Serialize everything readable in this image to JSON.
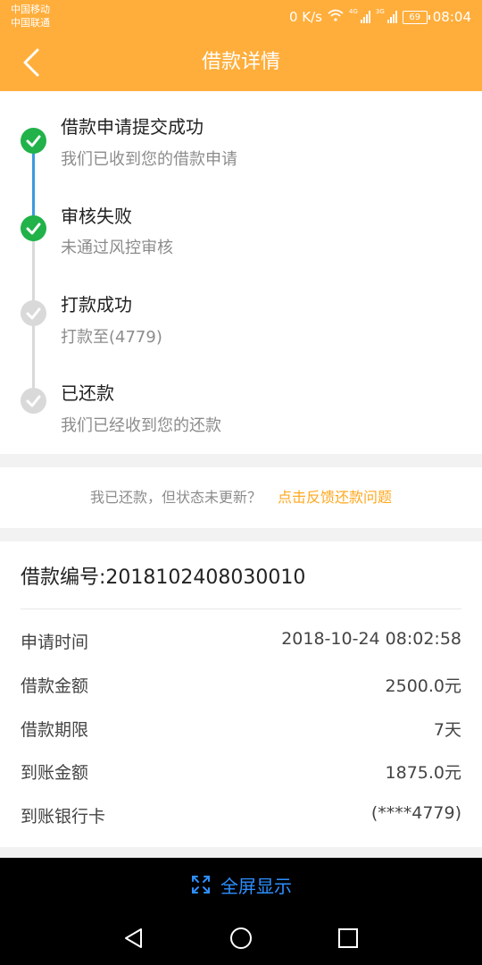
{
  "status_bar": {
    "carrier1": "中国移动",
    "carrier2": "中国联通",
    "net_speed": "0 K/s",
    "net1": "4G",
    "net2": "3G",
    "battery": "69",
    "time": "08:04"
  },
  "header": {
    "title": "借款详情",
    "back_icon": "chevron-left-icon"
  },
  "colors": {
    "accent": "#ffae3b",
    "success": "#21b24a",
    "pending": "#d9d9d9",
    "link": "#ffa81f",
    "progress_line": "#3a9be0"
  },
  "steps": [
    {
      "title": "借款申请提交成功",
      "subtitle": "我们已收到您的借款申请",
      "status": "done"
    },
    {
      "title": "审核失败",
      "subtitle": "未通过风控审核",
      "status": "done"
    },
    {
      "title": "打款成功",
      "subtitle": "打款至(4779)",
      "status": "pending"
    },
    {
      "title": "已还款",
      "subtitle": "我们已经收到您的还款",
      "status": "pending"
    }
  ],
  "feedback": {
    "question": "我已还款，但状态未更新？",
    "link": "点击反馈还款问题"
  },
  "loan": {
    "number_label": "借款编号:2018102408030010",
    "rows": [
      {
        "label": "申请时间",
        "value": "2018-10-24 08:02:58"
      },
      {
        "label": "借款金额",
        "value": "2500.0元"
      },
      {
        "label": "借款期限",
        "value": "7天"
      },
      {
        "label": "到账金额",
        "value": "1875.0元"
      },
      {
        "label": "到账银行卡",
        "value": "(****4779)"
      }
    ]
  },
  "fullscreen": {
    "label": "全屏显示",
    "icon": "expand-icon"
  },
  "nav": {
    "back_icon": "back-triangle-icon",
    "home_icon": "home-circle-icon",
    "recents_icon": "recents-square-icon"
  }
}
